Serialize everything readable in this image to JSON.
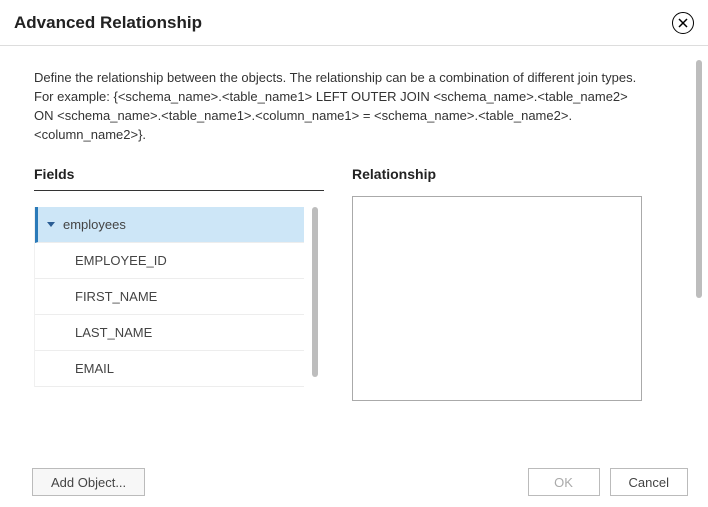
{
  "dialog": {
    "title": "Advanced Relationship",
    "description_line1": "Define the relationship between the objects. The relationship can be a combination of different join types.",
    "description_line2": "For example: {<schema_name>.<table_name1> LEFT OUTER JOIN <schema_name>.<table_name2> ON <schema_name>.<table_name1>.<column_name1> = <schema_name>.<table_name2>.<column_name2>}."
  },
  "fields": {
    "heading": "Fields",
    "tree": {
      "node": "employees",
      "children": [
        "EMPLOYEE_ID",
        "FIRST_NAME",
        "LAST_NAME",
        "EMAIL"
      ]
    }
  },
  "relationship": {
    "heading": "Relationship",
    "value": ""
  },
  "buttons": {
    "add_object": "Add Object...",
    "ok": "OK",
    "cancel": "Cancel"
  }
}
